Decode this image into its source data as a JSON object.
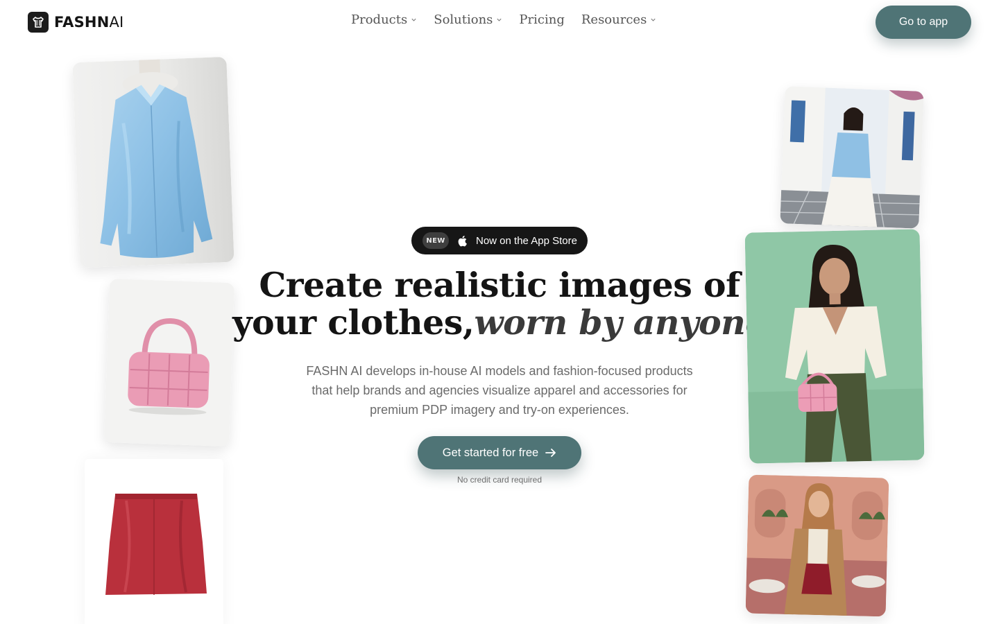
{
  "brand": {
    "name_bold": "FASHN",
    "name_light": "AI"
  },
  "nav": {
    "items": [
      {
        "label": "Products",
        "has_dropdown": true
      },
      {
        "label": "Solutions",
        "has_dropdown": true
      },
      {
        "label": "Pricing",
        "has_dropdown": false
      },
      {
        "label": "Resources",
        "has_dropdown": true
      }
    ],
    "cta_label": "Go to app"
  },
  "hero": {
    "badge": {
      "tag": "NEW",
      "icon": "apple-icon",
      "text": "Now on the App Store"
    },
    "headline_line1": "Create realistic images of",
    "headline_line2_plain": "your clothes,",
    "headline_line2_italic": "worn by anyone",
    "subtext": "FASHN AI develops in-house AI models and fashion-focused products that help brands and agencies visualize apparel and accessories for premium PDP imagery and try-on experiences.",
    "cta_label": "Get started for free",
    "cta_note": "No credit card required"
  },
  "colors": {
    "accent": "#4f7476",
    "dark": "#161616",
    "text_muted": "#6a6a6a",
    "background": "#ffffff"
  }
}
